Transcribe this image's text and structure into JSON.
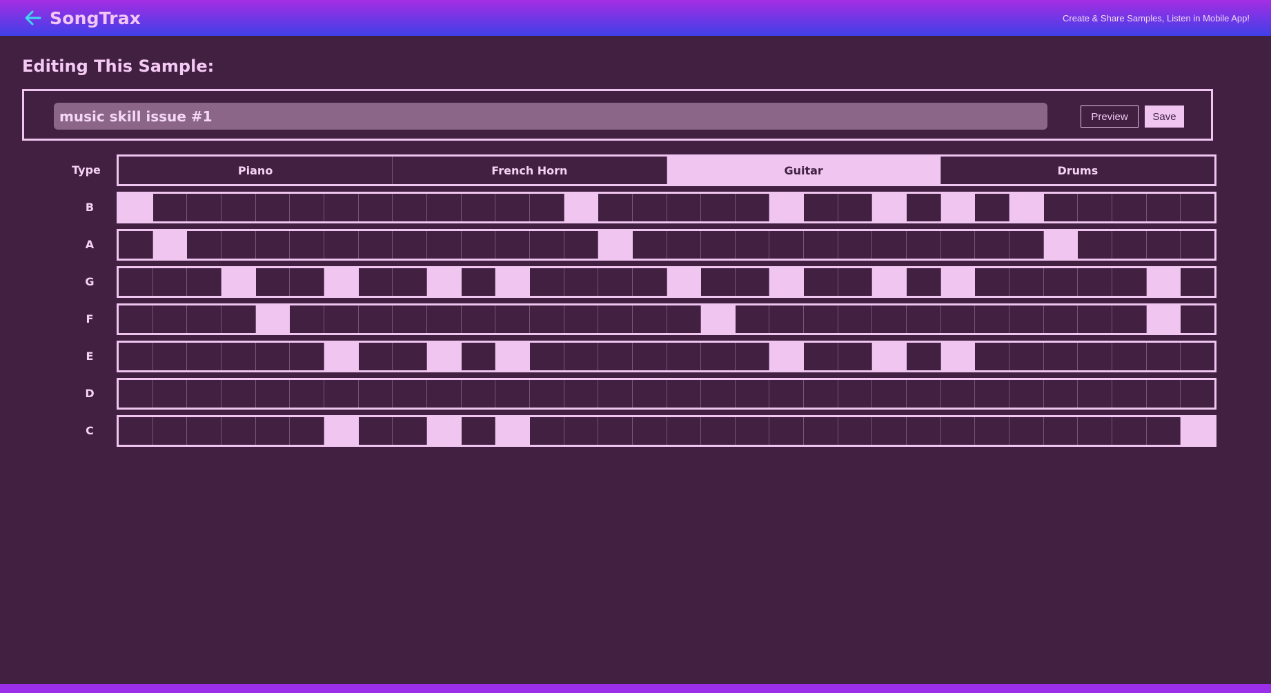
{
  "header": {
    "back_icon": "arrow-left-icon",
    "app_title": "SongTrax",
    "tagline": "Create & Share Samples, Listen in Mobile App!"
  },
  "editor": {
    "heading": "Editing This Sample:",
    "sample_name": "music skill issue #1",
    "preview_label": "Preview",
    "save_label": "Save"
  },
  "type_row": {
    "label": "Type",
    "options": [
      "Piano",
      "French Horn",
      "Guitar",
      "Drums"
    ],
    "selected": "Guitar"
  },
  "steps_per_row": 32,
  "notes": [
    {
      "label": "B",
      "active_steps": [
        1,
        14,
        20,
        23,
        25,
        27
      ]
    },
    {
      "label": "A",
      "active_steps": [
        2,
        15,
        28
      ]
    },
    {
      "label": "G",
      "active_steps": [
        4,
        7,
        10,
        12,
        17,
        20,
        23,
        25,
        31
      ]
    },
    {
      "label": "F",
      "active_steps": [
        5,
        18,
        31
      ]
    },
    {
      "label": "E",
      "active_steps": [
        7,
        10,
        12,
        20,
        23,
        25
      ]
    },
    {
      "label": "D",
      "active_steps": []
    },
    {
      "label": "C",
      "active_steps": [
        7,
        10,
        12,
        32
      ]
    }
  ],
  "colors": {
    "background": "#412042",
    "accent": "#f0c6f1",
    "header_top": "#a52ee3",
    "header_bottom": "#3f3fe8",
    "back_arrow": "#3fd8f0"
  }
}
